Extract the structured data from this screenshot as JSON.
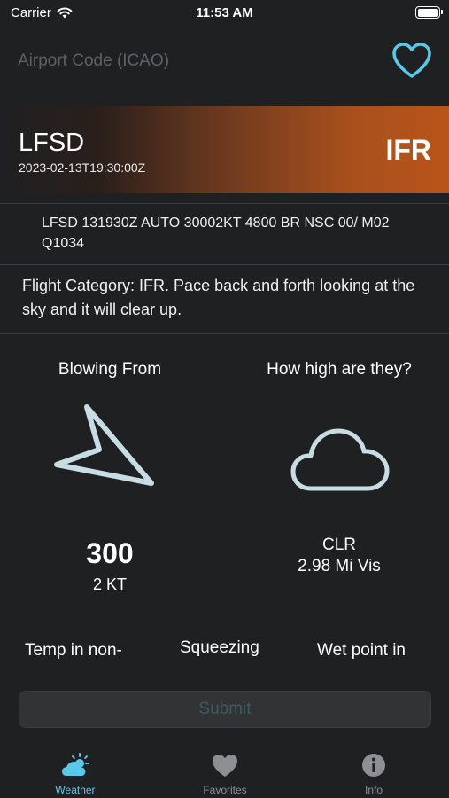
{
  "status_bar": {
    "carrier": "Carrier",
    "time": "11:53 AM"
  },
  "search": {
    "placeholder": "Airport Code (ICAO)",
    "value": "",
    "favorite_icon": "heart-outline-icon"
  },
  "station": {
    "id": "LFSD",
    "observation_time": "2023-02-13T19:30:00Z",
    "flight_category": "IFR",
    "raw_metar": "LFSD 131930Z AUTO 30002KT 4800 BR NSC 00/ M02 Q1034",
    "category_description": "Flight Category: IFR. Pace back and forth looking at the sky and it will clear up."
  },
  "wind": {
    "heading": "Blowing From",
    "direction": "300",
    "speed": "2 KT",
    "direction_degrees": 300
  },
  "sky": {
    "heading": "How high are they?",
    "cover": "CLR",
    "visibility": "2.98 Mi Vis"
  },
  "labels": {
    "temperature": "Temp in non-",
    "pressure": "Squeezing",
    "dewpoint": "Wet point in"
  },
  "submit_label": "Submit",
  "tabs": [
    {
      "label": "Weather",
      "icon": "weather-icon",
      "active": true
    },
    {
      "label": "Favorites",
      "icon": "heart-icon",
      "active": false
    },
    {
      "label": "Info",
      "icon": "info-icon",
      "active": false
    }
  ],
  "colors": {
    "accent": "#5ac8e8",
    "ifr_banner": "#b9541a",
    "icon_stroke": "#c8dce4",
    "background": "#1f2022"
  }
}
